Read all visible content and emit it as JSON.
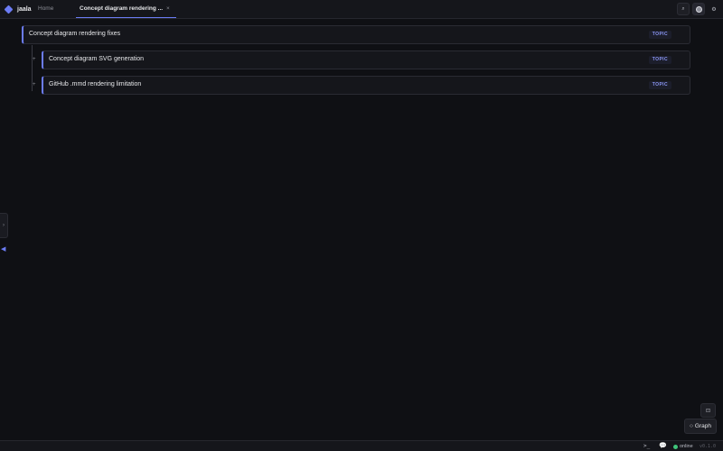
{
  "app": {
    "name": "jaala"
  },
  "tabs": [
    {
      "label": "Home"
    },
    {
      "label": "Concept diagram rendering ...",
      "close": "×"
    }
  ],
  "toolbar": {
    "search_icon_glyph": "⌕",
    "settings_glyph": "⚙"
  },
  "tree": {
    "root": {
      "title": "Concept diagram rendering fixes",
      "badge": "TOPIC"
    },
    "children": [
      {
        "expander": "+",
        "title": "Concept diagram SVG generation",
        "badge": "TOPIC"
      },
      {
        "expander": "+",
        "title": "GitHub .mmd rendering limitation",
        "badge": "TOPIC"
      }
    ]
  },
  "side": {
    "handle_glyph": "›",
    "collapse_glyph": "◀"
  },
  "floating": {
    "small_glyph": "⊡",
    "graph_label": "Graph",
    "graph_glyph": "○"
  },
  "statusbar": {
    "terminal": ">_",
    "chat_glyph": "💬",
    "status": "online",
    "version": "v0.1.0"
  },
  "colors": {
    "accent": "#6c7cf5",
    "online": "#3fc47a",
    "background": "#0f1014"
  }
}
